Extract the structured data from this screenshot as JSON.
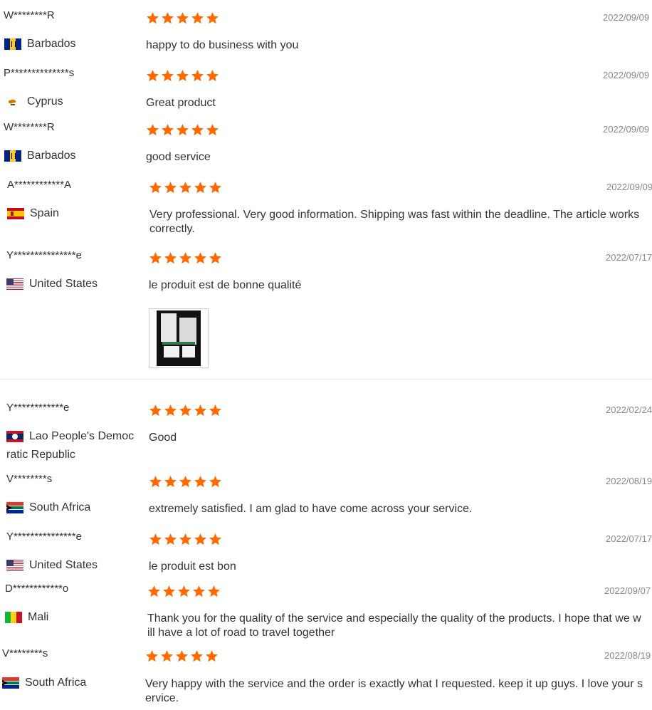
{
  "reviews": [
    {
      "name": "W********R",
      "country": "Barbados",
      "flag": "bb",
      "date": "2022/09/09",
      "text": "happy to do business with you"
    },
    {
      "name": "P**************s",
      "country": "Cyprus",
      "flag": "cy",
      "date": "2022/09/09",
      "text": "Great product"
    },
    {
      "name": "W********R",
      "country": "Barbados",
      "flag": "bb",
      "date": "2022/09/09",
      "text": "good service"
    },
    {
      "name": "A************A",
      "country": "Spain",
      "flag": "es",
      "date": "2022/09/09",
      "text": "Very professional. Very good information. Shipping was fast within the deadline. The article works correctly."
    },
    {
      "name": "Y***************e",
      "country": "United States",
      "flag": "us",
      "date": "2022/07/17",
      "text": "le produit est de bonne qualité"
    },
    {
      "name": "Y************e",
      "country": "Lao People's Democ ratic Republic",
      "country_line1": "Lao People's Democ",
      "country_line2": "ratic Republic",
      "flag": "la",
      "date": "2022/02/24",
      "text": "Good"
    },
    {
      "name": "V********s",
      "country": "South Africa",
      "flag": "za",
      "date": "2022/08/19",
      "text": "extremely satisfied. I am glad to have come across your service."
    },
    {
      "name": "Y***************e",
      "country": "United States",
      "flag": "us",
      "date": "2022/07/17",
      "text": "le produit est bon"
    },
    {
      "name": "D************o",
      "country": "Mali",
      "flag": "ml",
      "date": "2022/09/07",
      "text": "Thank you for the quality of the service and especially the quality of the products. I hope that we w ill have a lot of road to travel together"
    },
    {
      "name": "V********s",
      "country": "South Africa",
      "flag": "za",
      "date": "2022/08/19",
      "text": "Very happy with the service and the order is exactly what I requested. keep it up guys. I love your s ervice."
    }
  ],
  "rating_stars": 5,
  "colors": {
    "star": "#ff6a00",
    "date": "#888888",
    "text": "#333333",
    "divider": "#e6e6e6"
  }
}
